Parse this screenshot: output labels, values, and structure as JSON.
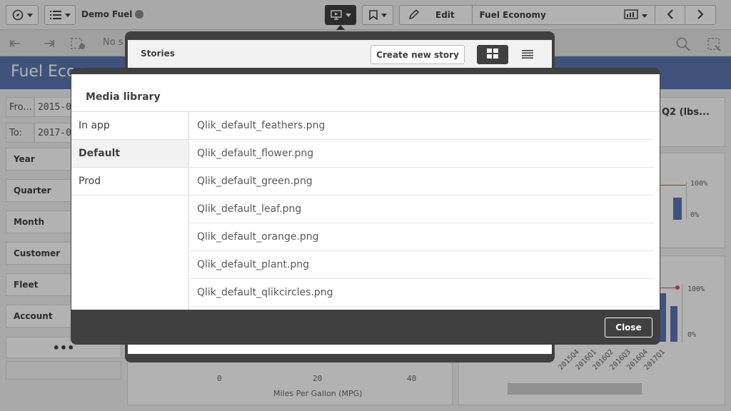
{
  "topbar": {
    "app_name": "Demo Fuel",
    "edit_label": "Edit",
    "sheet_name": "Fuel Economy"
  },
  "toolbar2": {
    "selection_text": "No s"
  },
  "sheet": {
    "title": "Fuel Econ"
  },
  "filters": {
    "from_label": "Fro...",
    "from_value": "2015-0",
    "to_label": "To:",
    "to_value": "2017-0",
    "panes": [
      "Year",
      "Quarter",
      "Month",
      "Customer",
      "Fleet",
      "Account"
    ],
    "more_label": "•••"
  },
  "background": {
    "kpi_title": "Q2 (lbs...",
    "pct_100_a": "100%",
    "pct_0_a": "0%",
    "pct_100_b": "100%",
    "pct_0_b": "0%",
    "axis_ticks": [
      "0",
      "20",
      "40"
    ],
    "axis_label": "Miles Per Gallon (MPG)",
    "quarters": [
      "2015Q4",
      "2016Q1",
      "2016Q2",
      "2016Q3",
      "2016Q4",
      "2017Q1"
    ]
  },
  "stories": {
    "title": "Stories",
    "create_label": "Create new story"
  },
  "media_library": {
    "title": "Media library",
    "folders": [
      {
        "label": "In app"
      },
      {
        "label": "Default"
      },
      {
        "label": "Prod"
      }
    ],
    "selected_folder": "Default",
    "files": [
      "Qlik_default_feathers.png",
      "Qlik_default_flower.png",
      "Qlik_default_green.png",
      "Qlik_default_leaf.png",
      "Qlik_default_orange.png",
      "Qlik_default_plant.png",
      "Qlik_default_qlikcircles.png"
    ],
    "close_label": "Close"
  },
  "colors": {
    "sheet_bar": "#5a76b0",
    "dark": "#404040"
  }
}
